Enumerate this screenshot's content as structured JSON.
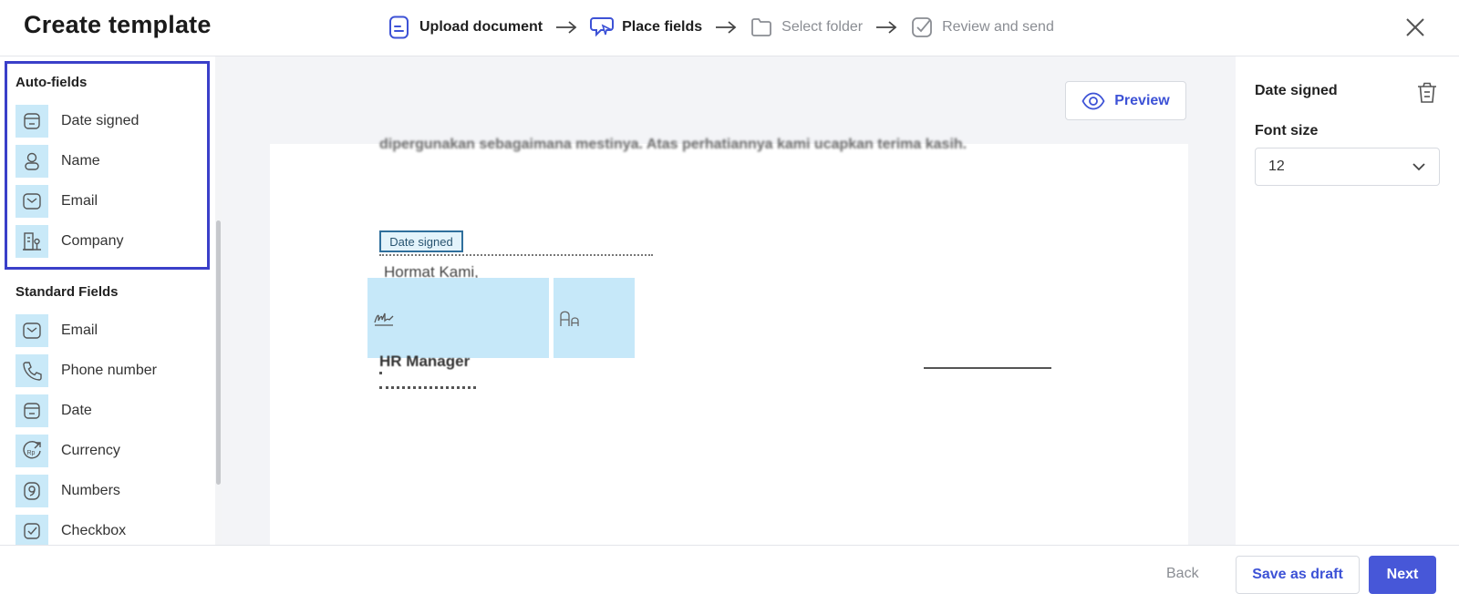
{
  "header": {
    "title": "Create template",
    "steps": [
      {
        "label": "Upload document",
        "icon": "document-icon",
        "state": "active"
      },
      {
        "label": "Place fields",
        "icon": "cursor-chat-icon",
        "state": "active"
      },
      {
        "label": "Select folder",
        "icon": "folder-icon",
        "state": "inactive"
      },
      {
        "label": "Review and send",
        "icon": "check-square-icon",
        "state": "inactive"
      }
    ]
  },
  "sidebar": {
    "auto_fields_title": "Auto-fields",
    "auto_fields": [
      {
        "label": "Date signed",
        "icon": "calendar-icon"
      },
      {
        "label": "Name",
        "icon": "person-icon"
      },
      {
        "label": "Email",
        "icon": "mail-icon"
      },
      {
        "label": "Company",
        "icon": "building-icon"
      }
    ],
    "standard_fields_title": "Standard Fields",
    "standard_fields": [
      {
        "label": "Email",
        "icon": "mail-icon"
      },
      {
        "label": "Phone number",
        "icon": "phone-icon"
      },
      {
        "label": "Date",
        "icon": "calendar-icon"
      },
      {
        "label": "Currency",
        "icon": "currency-icon"
      },
      {
        "label": "Numbers",
        "icon": "number-icon"
      },
      {
        "label": "Checkbox",
        "icon": "checkbox-icon"
      }
    ]
  },
  "canvas": {
    "preview_label": "Preview",
    "document": {
      "cut_text": "dipergunakan sebagaimana mestinya. Atas perhatiannya kami ucapkan terima kasih.",
      "date_chip": "Date signed",
      "closing": "Hormat Kami,",
      "role": "HR Manager"
    }
  },
  "right_panel": {
    "title": "Date signed",
    "font_size_label": "Font size",
    "font_size_value": "12"
  },
  "footer": {
    "back": "Back",
    "save_draft": "Save as draft",
    "next": "Next"
  },
  "colors": {
    "accent": "#4757d8",
    "highlight_border": "#3a3fc9",
    "field_bg": "#c9e9f8"
  }
}
